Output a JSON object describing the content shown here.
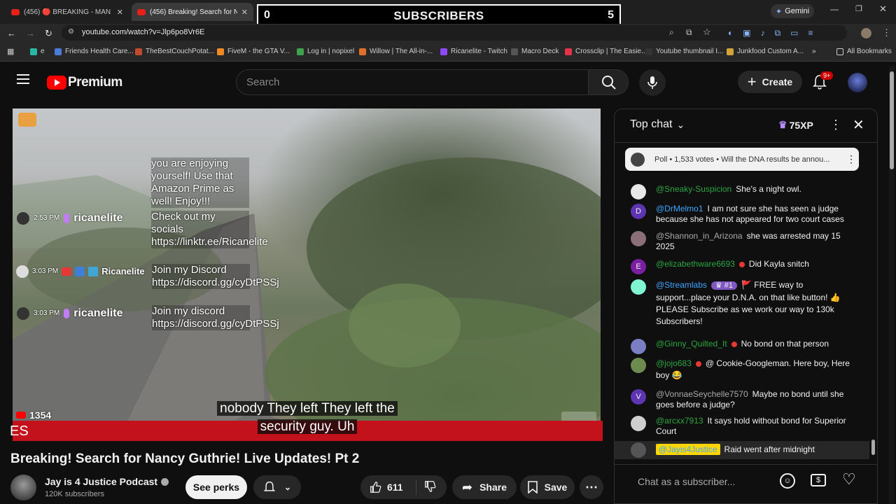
{
  "browser": {
    "tabs": [
      {
        "label": "(456) 🔴 BREAKING - MAN"
      },
      {
        "label": "(456) Breaking! Search for N"
      }
    ],
    "url": "youtube.com/watch?v=Jlp6po8Vr6E",
    "gemini_label": "Gemini",
    "bookmarks": [
      {
        "label": "e",
        "color": "#2bb5a5"
      },
      {
        "label": "Friends Health Care...",
        "color": "#4a7bd8"
      },
      {
        "label": "TheBestCouchPotat...",
        "color": "#c04a2a"
      },
      {
        "label": "FiveM - the GTA V...",
        "color": "#f08a24"
      },
      {
        "label": "Log in | nopixel",
        "color": "#3fa34d"
      },
      {
        "label": "Willow | The All-in-...",
        "color": "#e0702a"
      },
      {
        "label": "Ricanelite - Twitch",
        "color": "#9146ff"
      },
      {
        "label": "Macro Deck",
        "color": "#555555"
      },
      {
        "label": "Crossclip | The Easie...",
        "color": "#e2334b"
      },
      {
        "label": "Youtube thumbnail I...",
        "color": "#333333"
      },
      {
        "label": "Junkfood Custom A...",
        "color": "#d4a23a"
      }
    ],
    "all_bookmarks": "All Bookmarks"
  },
  "overlay": {
    "left_count": "0",
    "title": "SUBSCRIBERS",
    "right_count": "5"
  },
  "youtube": {
    "logo": "Premium",
    "search_placeholder": "Search",
    "create_label": "Create",
    "notif_count": "9+"
  },
  "video": {
    "stream_chat": [
      {
        "time": "2:53 PM",
        "name": "ricanelite",
        "platform": "kick"
      },
      {
        "time": "3:03 PM",
        "name": "Ricanelite",
        "platform": "twitch"
      },
      {
        "time": "3:03 PM",
        "name": "ricanelite",
        "platform": "kick"
      }
    ],
    "bubbles": [
      "you are enjoying yourself! Use that Amazon Prime as well! Enjoy!!!",
      "Check out my socials https://linktr.ee/Ricanelite",
      "Join my Discord https://discord.gg/cyDtPSSj",
      "Join my discord https://discord.gg/cyDtPSSj"
    ],
    "viewer_count": "1354",
    "caption_line1": "nobody They left They left the",
    "caption_line2": "security guy. Uh",
    "ticker_text": "ES"
  },
  "meta": {
    "title": "Breaking! Search for Nancy Guthrie! Live Updates! Pt 2",
    "channel": "Jay is 4 Justice Podcast",
    "subscribers": "120K subscribers",
    "see_perks": "See perks",
    "likes": "611",
    "share": "Share",
    "save": "Save"
  },
  "chat": {
    "header": "Top chat",
    "xp": "75XP",
    "poll_text": "Poll • 1,533 votes • Will the DNA results be annou...",
    "input_placeholder": "Chat as a subscriber...",
    "messages": [
      {
        "user": "@Sneaky-Suspicion",
        "text": "She's a night owl.",
        "color": "#2ba640",
        "avatar": "#e8e8e8"
      },
      {
        "user": "@DrMelmo1",
        "text": "I am not sure she has seen a judge because she has not appeared for two court cases",
        "color": "#3ea6ff",
        "avatar": "#5e35b1",
        "initial": "D"
      },
      {
        "user": "@Shannon_in_Arizona",
        "text": "she was arrested may 15 2025",
        "color": "#aaaaaa",
        "avatar": "#8a6f7a"
      },
      {
        "user": "@elizabethware6693",
        "text": "Did Kayla snitch",
        "color": "#2ba640",
        "avatar": "#7b1fa2",
        "initial": "E"
      },
      {
        "user": "@Streamlabs",
        "text": "🚩 FREE way to support...place your D.N.A. on that like button! 👍 PLEASE Subscribe as we work our way to 130k Subscribers!",
        "color": "#3ea6ff",
        "avatar": "#80f5d2",
        "badge": "#1"
      },
      {
        "user": "@Ginny_Quilted_It",
        "text": "No bond on that person",
        "color": "#2ba640",
        "avatar": "#7a7fc4"
      },
      {
        "user": "@jojo683",
        "text": "@ Cookie-Googleman. Here boy, Here boy 😂",
        "color": "#2ba640",
        "avatar": "#6d8a4f"
      },
      {
        "user": "@VonnaeSeychelle7570",
        "text": "Maybe no bond until she goes before a judge?",
        "color": "#aaaaaa",
        "avatar": "#5e35b1",
        "initial": "V"
      },
      {
        "user": "@arcxx7913",
        "text": "It says hold without bond for Superior Court",
        "color": "#2ba640",
        "avatar": "#cfcfcf"
      },
      {
        "user": "@Jayis4Justice",
        "text": "Raid went after midnight",
        "color": "#0f0f0f",
        "avatar": "#555555",
        "owner": true
      }
    ]
  }
}
